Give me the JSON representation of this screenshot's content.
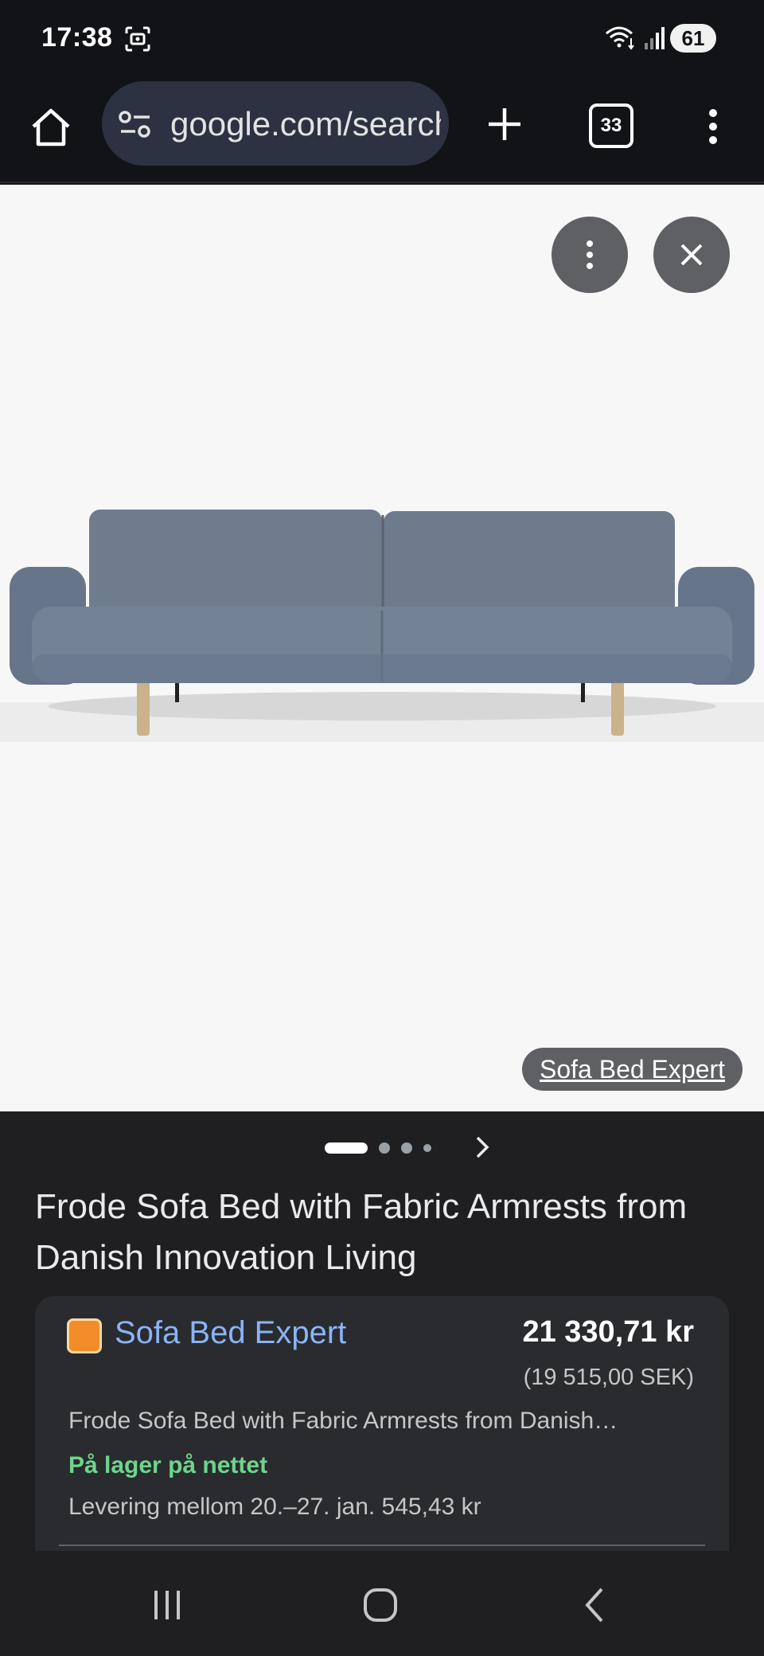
{
  "status_bar": {
    "time": "17:38",
    "battery": "61",
    "icons": [
      "screen-record-icon",
      "wifi-icon",
      "signal-icon",
      "battery-icon"
    ]
  },
  "browser": {
    "url": "google.com/search",
    "tab_count": "33",
    "icons": [
      "home-icon",
      "site-settings-icon",
      "plus-icon",
      "more-vert-icon"
    ]
  },
  "image_viewer": {
    "image_subject": "grey fabric sofa bed with wooden legs",
    "source_label": "Sofa Bed Expert",
    "icons": [
      "more-vert-icon",
      "close-icon"
    ],
    "pager": {
      "total": 4,
      "active": 1
    }
  },
  "product": {
    "title": "Frode Sofa Bed with Fabric Armrests from Danish Innovation Living",
    "offer": {
      "merchant": "Sofa Bed Expert",
      "price": "21 330,71 kr",
      "original_price": "(19 515,00 SEK)",
      "description": "Frode Sofa Bed with Fabric Armrests from Danish…",
      "stock": "På lager på nettet",
      "delivery": "Levering mellom 20.–27. jan. 545,43 kr"
    }
  },
  "nav_bar": {
    "icons": [
      "recent-apps-icon",
      "home-icon",
      "back-icon"
    ]
  },
  "colors": {
    "background": "#121316",
    "panel": "#1f1f21",
    "card": "#2a2b2e",
    "link": "#8ab4f8",
    "in_stock": "#6dd58c",
    "sofa": "#6d7b8c"
  }
}
